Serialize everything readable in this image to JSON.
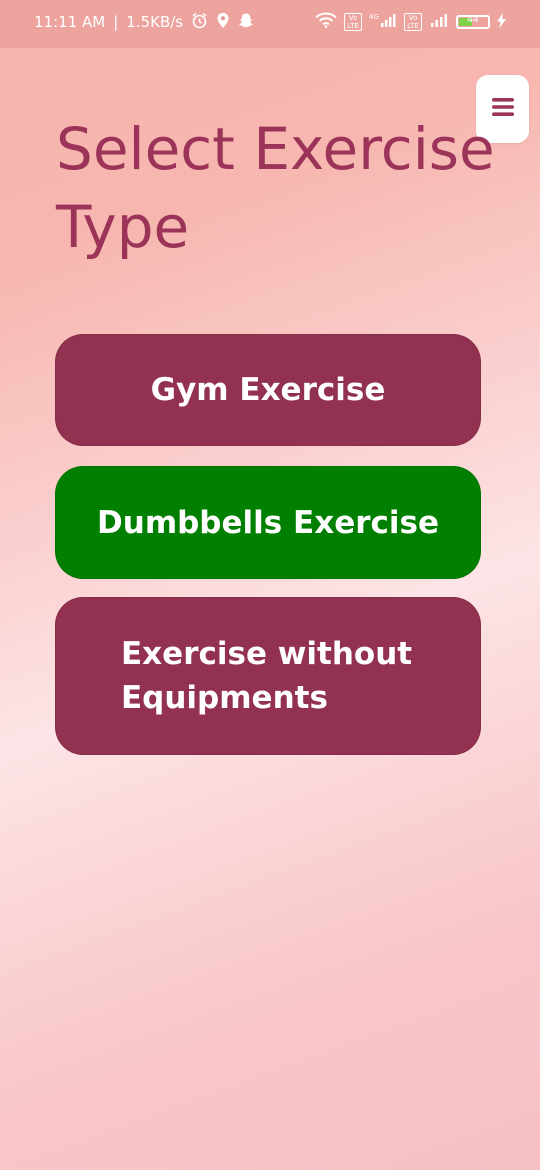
{
  "status_bar": {
    "time": "11:11 AM",
    "separator": "|",
    "network_speed": "1.5KB/s",
    "alarm_icon": "alarm-clock-icon",
    "location_icon": "location-pin-icon",
    "snapchat_icon": "snapchat-ghost-icon",
    "wifi_icon": "wifi-icon",
    "volte_label": "Vo LTE",
    "network_type": "4G",
    "battery_level": "44",
    "charging_icon": "lightning-bolt-icon"
  },
  "menu": {
    "icon": "hamburger-menu-icon",
    "color": "#9b3458"
  },
  "page": {
    "title": "Select Exercise Type"
  },
  "options": [
    {
      "label": "Gym Exercise",
      "color": "#923250"
    },
    {
      "label": "Dumbbells Exercise",
      "color": "#007f00"
    },
    {
      "label": "Exercise without Equipments",
      "color": "#923250"
    }
  ],
  "colors": {
    "title": "#9b3458",
    "primary_button": "#923250",
    "selected_button": "#007f00"
  }
}
